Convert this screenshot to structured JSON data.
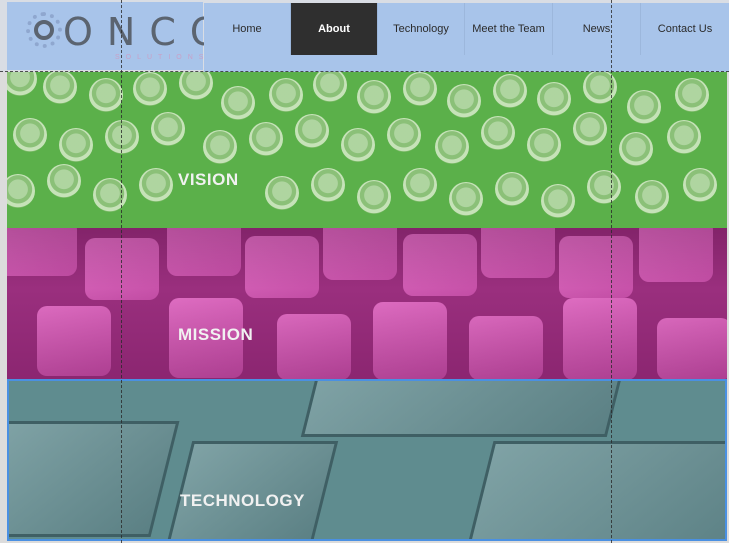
{
  "logo": {
    "word": "ONCO",
    "sub": "SOLUTIONS"
  },
  "nav": {
    "items": [
      {
        "label": "Home"
      },
      {
        "label": "About",
        "active": true
      },
      {
        "label": "Technology"
      },
      {
        "label": "Meet the Team"
      },
      {
        "label": "News"
      },
      {
        "label": "Contact Us"
      }
    ]
  },
  "sections": {
    "vision": {
      "title": "VISION"
    },
    "mission": {
      "title": "MISSION"
    },
    "technology": {
      "title": "TECHNOLOGY",
      "selected": true
    }
  },
  "colors": {
    "nav_bg": "#a8c4ea",
    "nav_active": "#2f2f2f",
    "vision": "#5bb04a",
    "mission": "#9a2f7e",
    "technology": "#5f8c8f",
    "selection": "#4a90e2"
  }
}
